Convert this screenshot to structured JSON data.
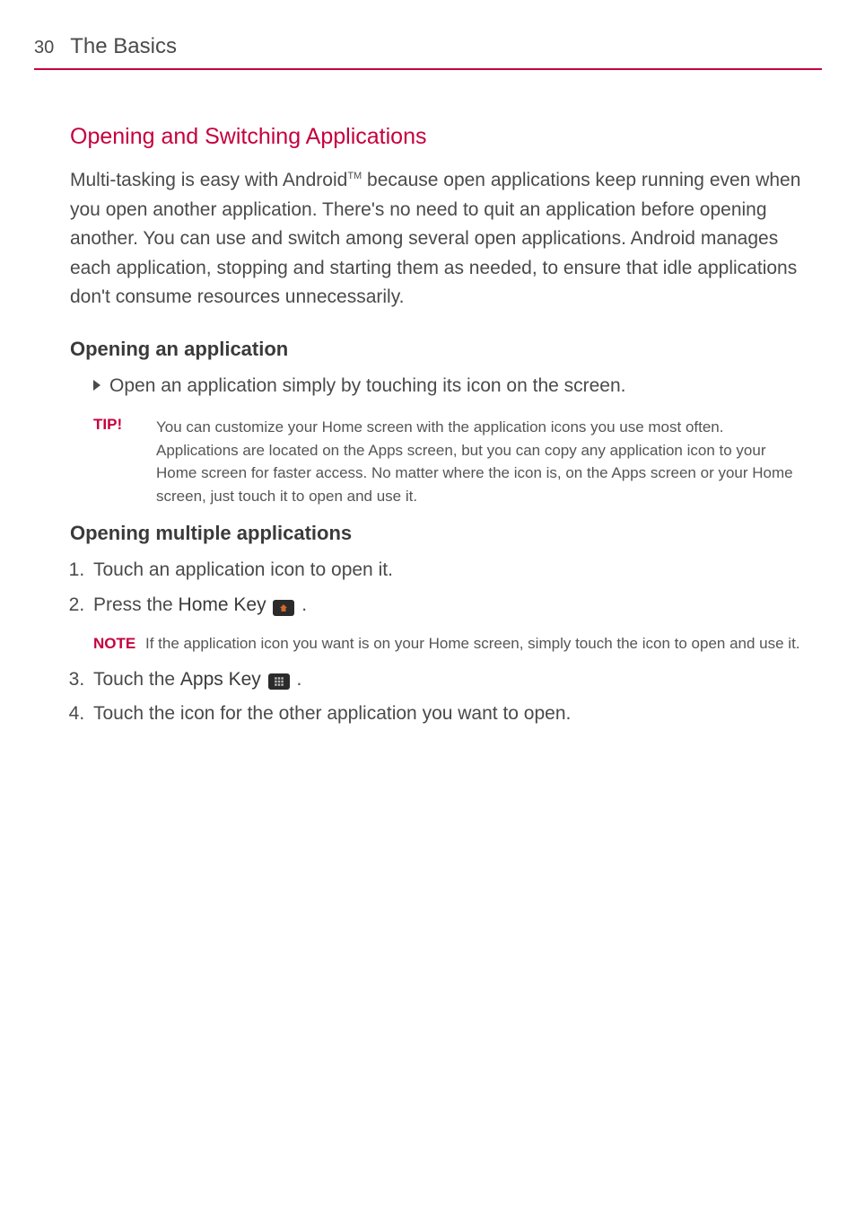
{
  "header": {
    "page_number": "30",
    "section_title": "The Basics"
  },
  "main": {
    "heading": "Opening and Switching Applications",
    "intro_pre": "Multi-tasking is easy with Android",
    "intro_tm": "TM",
    "intro_post": " because open applications keep running even when you open another application. There's no need to quit an application before opening another. You can use and switch among several open applications. Android manages each application, stopping and starting them as needed, to ensure that idle applications don't consume resources unnecessarily.",
    "sub1": {
      "title": "Opening an application",
      "bullet": "Open an application simply by touching its icon on the screen.",
      "tip_label": "TIP!",
      "tip_body": "You can customize your Home screen with the application icons you use most often. Applications are located on the Apps screen, but you can copy any application icon to your Home screen for faster access. No matter where the icon is, on the Apps screen or your Home screen, just touch it to open and use it."
    },
    "sub2": {
      "title": "Opening multiple applications",
      "step1": "Touch an application icon to open it.",
      "step2_pre": "Press the ",
      "step2_key": "Home Key",
      "step2_post": " .",
      "note_label": "NOTE",
      "note_body": "If the application icon you want is on your Home screen, simply touch the icon to open and use it.",
      "step3_pre": "Touch the ",
      "step3_key": "Apps Key",
      "step3_post": " .",
      "step4": "Touch the icon for the other application you want to open."
    }
  }
}
